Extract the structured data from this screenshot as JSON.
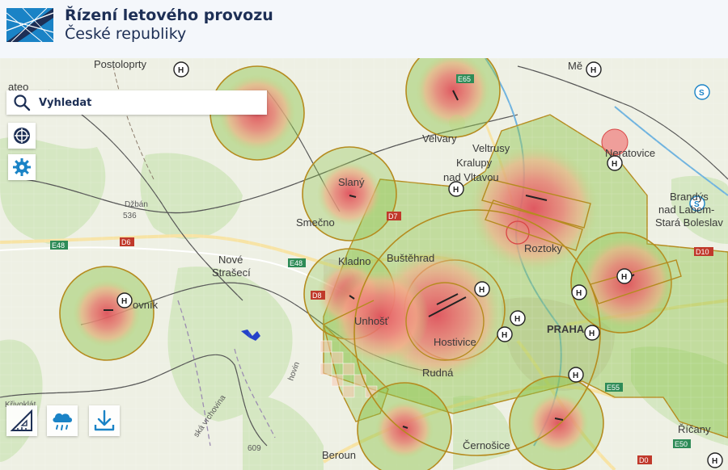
{
  "header": {
    "org_line1": "Řízení letového provozu",
    "org_line2": "České republiky"
  },
  "toolbar": {
    "search_label": "Vyhledat"
  },
  "map": {
    "places": {
      "postoloprty": "Postoloprty",
      "velvary": "Velvary",
      "veltrusy": "Veltrusy",
      "kralupy": "Kralupy",
      "nad_vltavou": "nad Vltavou",
      "neratovice": "Neratovice",
      "slany": "Slaný",
      "smecno": "Smečno",
      "kladno": "Kladno",
      "bustehrad": "Buštěhrad",
      "roztoky": "Roztoky",
      "nove": "Nové",
      "straseci": "Strašecí",
      "unhost": "Unhošť",
      "hostivice": "Hostivice",
      "praha": "PRAHA",
      "rudna": "Rudná",
      "beroun": "Beroun",
      "cernosice": "Černošice",
      "ricany": "Říčany",
      "brandys": "Brandýs",
      "nad_labem": "nad Labem-",
      "stara_boleslav": "Stará Boleslav",
      "rakovnik_frag": "ovník",
      "melnik_frag": "Mě",
      "zatec_frag": "ateo",
      "dibrava_frag": "Džbán",
      "krivoklat_frag": "Křivoklát",
      "hory_frag": "ská vrchovina",
      "vrch_frag": "hovin"
    },
    "elevations": [
      "536",
      "609"
    ],
    "roads": [
      "E48",
      "D6",
      "D7",
      "D0",
      "E55",
      "E50",
      "E65",
      "D10",
      "D8",
      "E48"
    ],
    "heliports": 14,
    "zones": [
      "heat-zone-ctr",
      "drone-restriction"
    ]
  },
  "colors": {
    "header_text": "#1d2f55",
    "accent_blue": "#1a83c6",
    "zone_green": "#8bc34a",
    "zone_border": "#b58b1e",
    "heat_red": "#e8505b",
    "heat_orange": "#f4a38a"
  },
  "icons": {
    "search": "search-icon",
    "compass": "compass-icon",
    "settings": "gear-icon",
    "measure": "ruler-icon",
    "weather": "weather-icon",
    "download": "download-icon"
  }
}
